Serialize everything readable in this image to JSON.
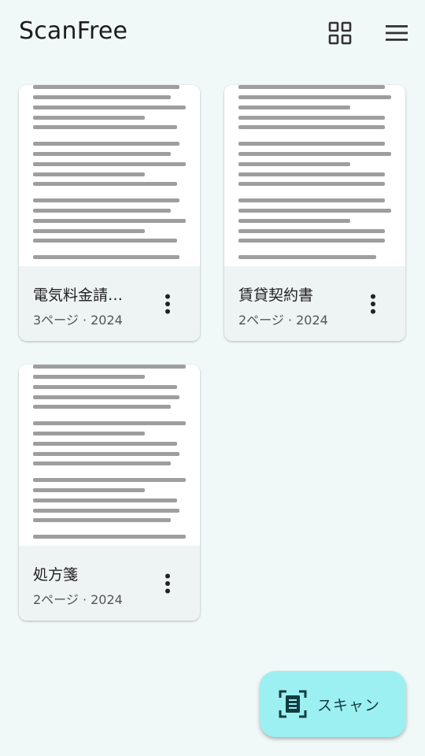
{
  "app": {
    "title": "ScanFree"
  },
  "toolbar": {
    "grid_icon": "grid-view-icon",
    "menu_icon": "hamburger-menu-icon"
  },
  "documents": [
    {
      "title": "電気料金請求書",
      "meta": "3ページ · 2024"
    },
    {
      "title": "賃貸契約書",
      "meta": "2ページ · 2024"
    },
    {
      "title": "処方箋",
      "meta": "2ページ · 2024"
    }
  ],
  "fab": {
    "label": "スキャン",
    "icon": "document-scanner-icon"
  },
  "colors": {
    "background": "#F1F8F8",
    "card_footer": "#EEF3F3",
    "fab": "#9DF0F2",
    "text_line": "#9E9E9E",
    "icon": "#333333"
  }
}
